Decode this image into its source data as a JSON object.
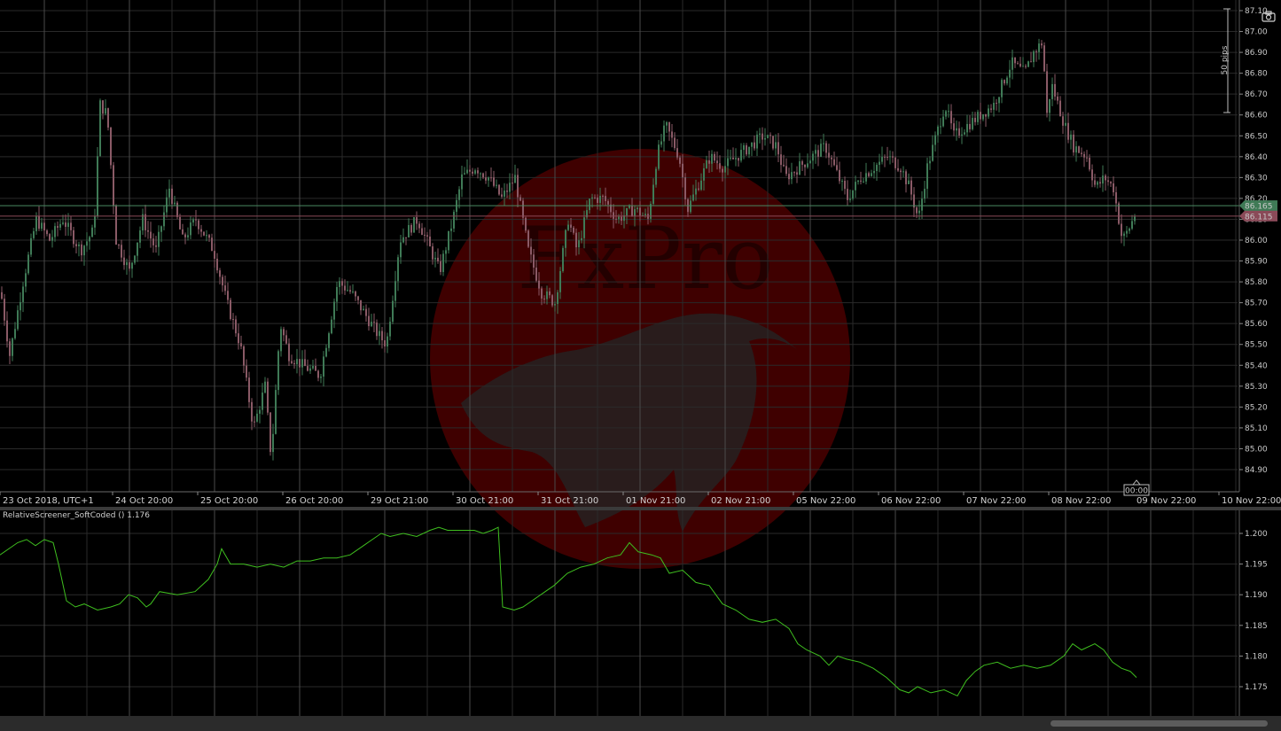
{
  "indicator": {
    "title": "RelativeScreener_SoftCoded () 1.176"
  },
  "watermark": {
    "brand": "FxPro"
  },
  "price_axis": {
    "pips_label": "50 pips",
    "labels": [
      "87.10",
      "87.00",
      "86.90",
      "86.80",
      "86.70",
      "86.60",
      "86.50",
      "86.40",
      "86.30",
      "86.20",
      "86.10",
      "86.00",
      "85.90",
      "85.80",
      "85.70",
      "85.60",
      "85.50",
      "85.40",
      "85.30",
      "85.20",
      "85.10",
      "85.00",
      "84.90"
    ],
    "ask_label": "86.165",
    "bid_label": "86.115"
  },
  "indicator_axis": {
    "labels": [
      "1.200",
      "1.195",
      "1.190",
      "1.185",
      "1.180",
      "1.175"
    ]
  },
  "time_axis": {
    "labels": [
      "23 Oct 2018, UTC+1",
      "24 Oct 20:00",
      "25 Oct 20:00",
      "26 Oct 20:00",
      "29 Oct 21:00",
      "30 Oct 21:00",
      "31 Oct 21:00",
      "01 Nov 21:00",
      "02 Nov 21:00",
      "05 Nov 22:00",
      "06 Nov 22:00",
      "07 Nov 22:00",
      "08 Nov 22:00",
      "09 Nov 22:00",
      "10 Nov 22:00"
    ],
    "countdown": "00:00"
  },
  "colors": {
    "background": "#000000",
    "grid": "#2a2a2a",
    "bull_candle": "#3f7a56",
    "bear_candle": "#8a5a66",
    "ask_line": "#4a8a62",
    "bid_line": "#8a4a58",
    "indicator_line": "#3fbf1f",
    "watermark": "#5a0000"
  },
  "chart_data": [
    {
      "type": "candlestick",
      "title": "",
      "ylim": [
        84.85,
        87.12
      ],
      "ask": 86.165,
      "bid": 86.115,
      "anchors": [
        [
          0,
          85.75
        ],
        [
          10,
          85.45
        ],
        [
          25,
          85.8
        ],
        [
          40,
          86.1
        ],
        [
          55,
          86.0
        ],
        [
          70,
          86.1
        ],
        [
          90,
          85.95
        ],
        [
          105,
          86.05
        ],
        [
          112,
          86.65
        ],
        [
          120,
          86.6
        ],
        [
          130,
          86.0
        ],
        [
          145,
          85.85
        ],
        [
          160,
          86.1
        ],
        [
          175,
          85.95
        ],
        [
          190,
          86.25
        ],
        [
          205,
          86.0
        ],
        [
          220,
          86.1
        ],
        [
          240,
          85.95
        ],
        [
          255,
          85.7
        ],
        [
          270,
          85.5
        ],
        [
          285,
          85.1
        ],
        [
          298,
          85.3
        ],
        [
          305,
          84.95
        ],
        [
          315,
          85.6
        ],
        [
          325,
          85.45
        ],
        [
          340,
          85.4
        ],
        [
          360,
          85.35
        ],
        [
          380,
          85.8
        ],
        [
          395,
          85.75
        ],
        [
          410,
          85.65
        ],
        [
          425,
          85.55
        ],
        [
          435,
          85.5
        ],
        [
          450,
          86.0
        ],
        [
          470,
          86.1
        ],
        [
          485,
          85.95
        ],
        [
          495,
          85.85
        ],
        [
          510,
          86.1
        ],
        [
          520,
          86.3
        ],
        [
          535,
          86.35
        ],
        [
          550,
          86.3
        ],
        [
          565,
          86.2
        ],
        [
          580,
          86.3
        ],
        [
          595,
          85.95
        ],
        [
          610,
          85.75
        ],
        [
          625,
          85.7
        ],
        [
          640,
          86.1
        ],
        [
          650,
          85.95
        ],
        [
          665,
          86.2
        ],
        [
          680,
          86.2
        ],
        [
          695,
          86.1
        ],
        [
          715,
          86.15
        ],
        [
          730,
          86.1
        ],
        [
          740,
          86.4
        ],
        [
          750,
          86.55
        ],
        [
          765,
          86.4
        ],
        [
          775,
          86.15
        ],
        [
          785,
          86.25
        ],
        [
          800,
          86.4
        ],
        [
          815,
          86.35
        ],
        [
          830,
          86.4
        ],
        [
          845,
          86.45
        ],
        [
          860,
          86.5
        ],
        [
          875,
          86.45
        ],
        [
          885,
          86.3
        ],
        [
          900,
          86.35
        ],
        [
          915,
          86.4
        ],
        [
          930,
          86.45
        ],
        [
          945,
          86.3
        ],
        [
          955,
          86.2
        ],
        [
          970,
          86.3
        ],
        [
          985,
          86.35
        ],
        [
          1000,
          86.4
        ],
        [
          1015,
          86.35
        ],
        [
          1025,
          86.25
        ],
        [
          1035,
          86.1
        ],
        [
          1045,
          86.35
        ],
        [
          1055,
          86.5
        ],
        [
          1065,
          86.65
        ],
        [
          1075,
          86.5
        ],
        [
          1090,
          86.55
        ],
        [
          1105,
          86.6
        ],
        [
          1120,
          86.65
        ],
        [
          1130,
          86.75
        ],
        [
          1140,
          86.85
        ],
        [
          1155,
          86.8
        ],
        [
          1165,
          86.9
        ],
        [
          1175,
          86.95
        ],
        [
          1180,
          86.6
        ],
        [
          1185,
          86.75
        ],
        [
          1200,
          86.55
        ],
        [
          1210,
          86.45
        ],
        [
          1225,
          86.4
        ],
        [
          1235,
          86.25
        ],
        [
          1245,
          86.3
        ],
        [
          1255,
          86.25
        ],
        [
          1265,
          86.0
        ],
        [
          1272,
          86.05
        ],
        [
          1280,
          86.13
        ]
      ]
    },
    {
      "type": "line",
      "title": "",
      "ylim": [
        1.172,
        1.2025
      ],
      "x": [
        0,
        20,
        30,
        40,
        50,
        60,
        66,
        75,
        85,
        95,
        110,
        125,
        135,
        145,
        155,
        165,
        170,
        180,
        200,
        220,
        235,
        245,
        250,
        260,
        275,
        290,
        305,
        320,
        335,
        350,
        365,
        380,
        395,
        410,
        420,
        430,
        440,
        455,
        470,
        485,
        495,
        505,
        520,
        535,
        545,
        555,
        562,
        567,
        580,
        590,
        600,
        615,
        625,
        640,
        655,
        670,
        685,
        700,
        710,
        720,
        735,
        745,
        755,
        770,
        785,
        800,
        815,
        830,
        845,
        860,
        875,
        890,
        900,
        910,
        925,
        935,
        945,
        955,
        970,
        985,
        1000,
        1015,
        1025,
        1035,
        1050,
        1065,
        1080,
        1090,
        1100,
        1110,
        1125,
        1140,
        1155,
        1170,
        1185,
        1200,
        1210,
        1220,
        1235,
        1245,
        1255,
        1265,
        1275,
        1282
      ],
      "y": [
        1.1965,
        1.1985,
        1.199,
        1.198,
        1.199,
        1.1985,
        1.195,
        1.189,
        1.188,
        1.1885,
        1.1875,
        1.188,
        1.1885,
        1.19,
        1.1895,
        1.188,
        1.1885,
        1.1905,
        1.19,
        1.1905,
        1.1925,
        1.195,
        1.1975,
        1.195,
        1.195,
        1.1945,
        1.195,
        1.1945,
        1.1955,
        1.1955,
        1.196,
        1.196,
        1.1965,
        1.198,
        1.199,
        1.2,
        1.1995,
        1.2,
        1.1995,
        1.2005,
        1.201,
        1.2005,
        1.2005,
        1.2005,
        1.2,
        1.2005,
        1.201,
        1.188,
        1.1875,
        1.188,
        1.189,
        1.1905,
        1.1915,
        1.1935,
        1.1945,
        1.195,
        1.196,
        1.1965,
        1.1985,
        1.197,
        1.1965,
        1.196,
        1.1935,
        1.194,
        1.192,
        1.1915,
        1.1885,
        1.1875,
        1.186,
        1.1855,
        1.186,
        1.1845,
        1.182,
        1.181,
        1.18,
        1.1785,
        1.18,
        1.1795,
        1.179,
        1.178,
        1.1765,
        1.1745,
        1.174,
        1.175,
        1.174,
        1.1745,
        1.1735,
        1.176,
        1.1775,
        1.1785,
        1.179,
        1.178,
        1.1785,
        1.178,
        1.1785,
        1.18,
        1.182,
        1.181,
        1.182,
        1.181,
        1.179,
        1.178,
        1.1775,
        1.1765
      ]
    }
  ]
}
